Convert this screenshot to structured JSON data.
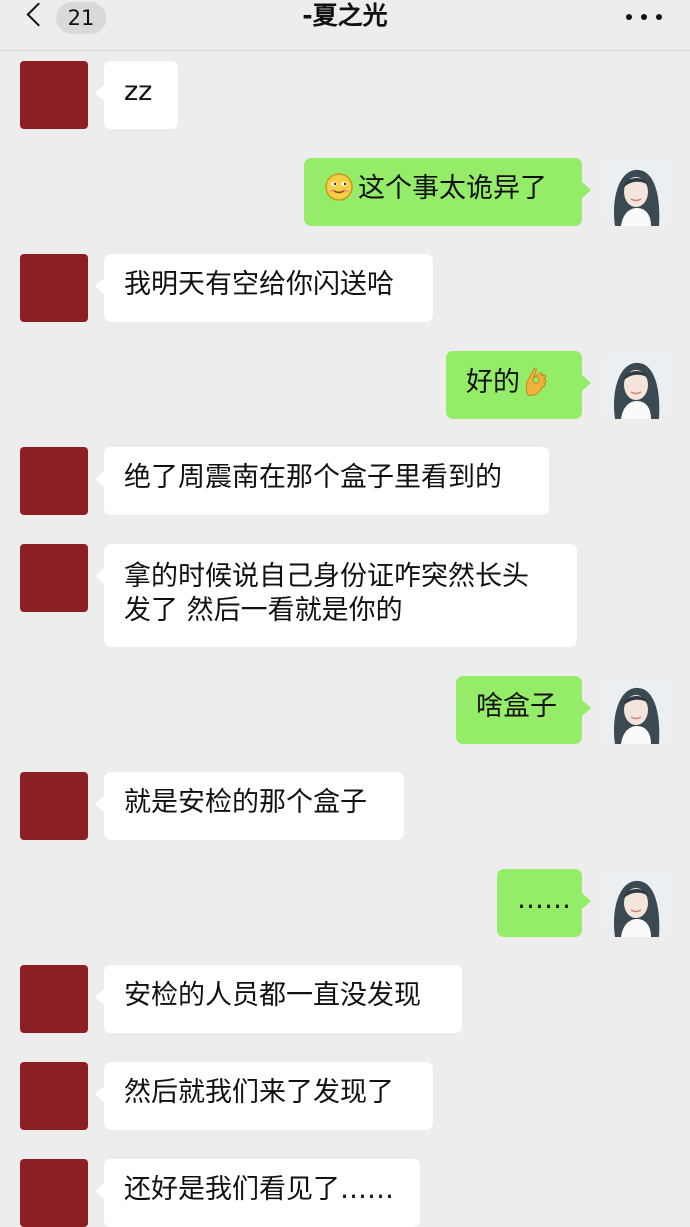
{
  "header": {
    "back_icon": "chevron-left-icon",
    "unread_count": "21",
    "title": "-夏之光",
    "more_icon": "more-horizontal-icon"
  },
  "colors": {
    "background": "#ededed",
    "incoming_bubble": "#ffffff",
    "outgoing_bubble": "#95ec69",
    "contact_avatar": "#8b1f24"
  },
  "messages": [
    {
      "side": "in",
      "text": "zz"
    },
    {
      "side": "out",
      "emoji_before": "smile-emoji-icon",
      "text": "这个事太诡异了"
    },
    {
      "side": "in",
      "text": "我明天有空给你闪送哈"
    },
    {
      "side": "out",
      "text": "好的",
      "emoji_after": "ok-hand-emoji-icon"
    },
    {
      "side": "in",
      "text": "绝了周震南在那个盒子里看到的"
    },
    {
      "side": "in",
      "lines": [
        "拿的时候说自己身份证咋突然长头",
        "发了 然后一看就是你的"
      ]
    },
    {
      "side": "out",
      "text": "啥盒子"
    },
    {
      "side": "in",
      "text": "就是安检的那个盒子"
    },
    {
      "side": "out",
      "text": "……"
    },
    {
      "side": "in",
      "text": "安检的人员都一直没发现"
    },
    {
      "side": "in",
      "text": "然后就我们来了发现了"
    },
    {
      "side": "in",
      "text": "还好是我们看见了……"
    }
  ]
}
